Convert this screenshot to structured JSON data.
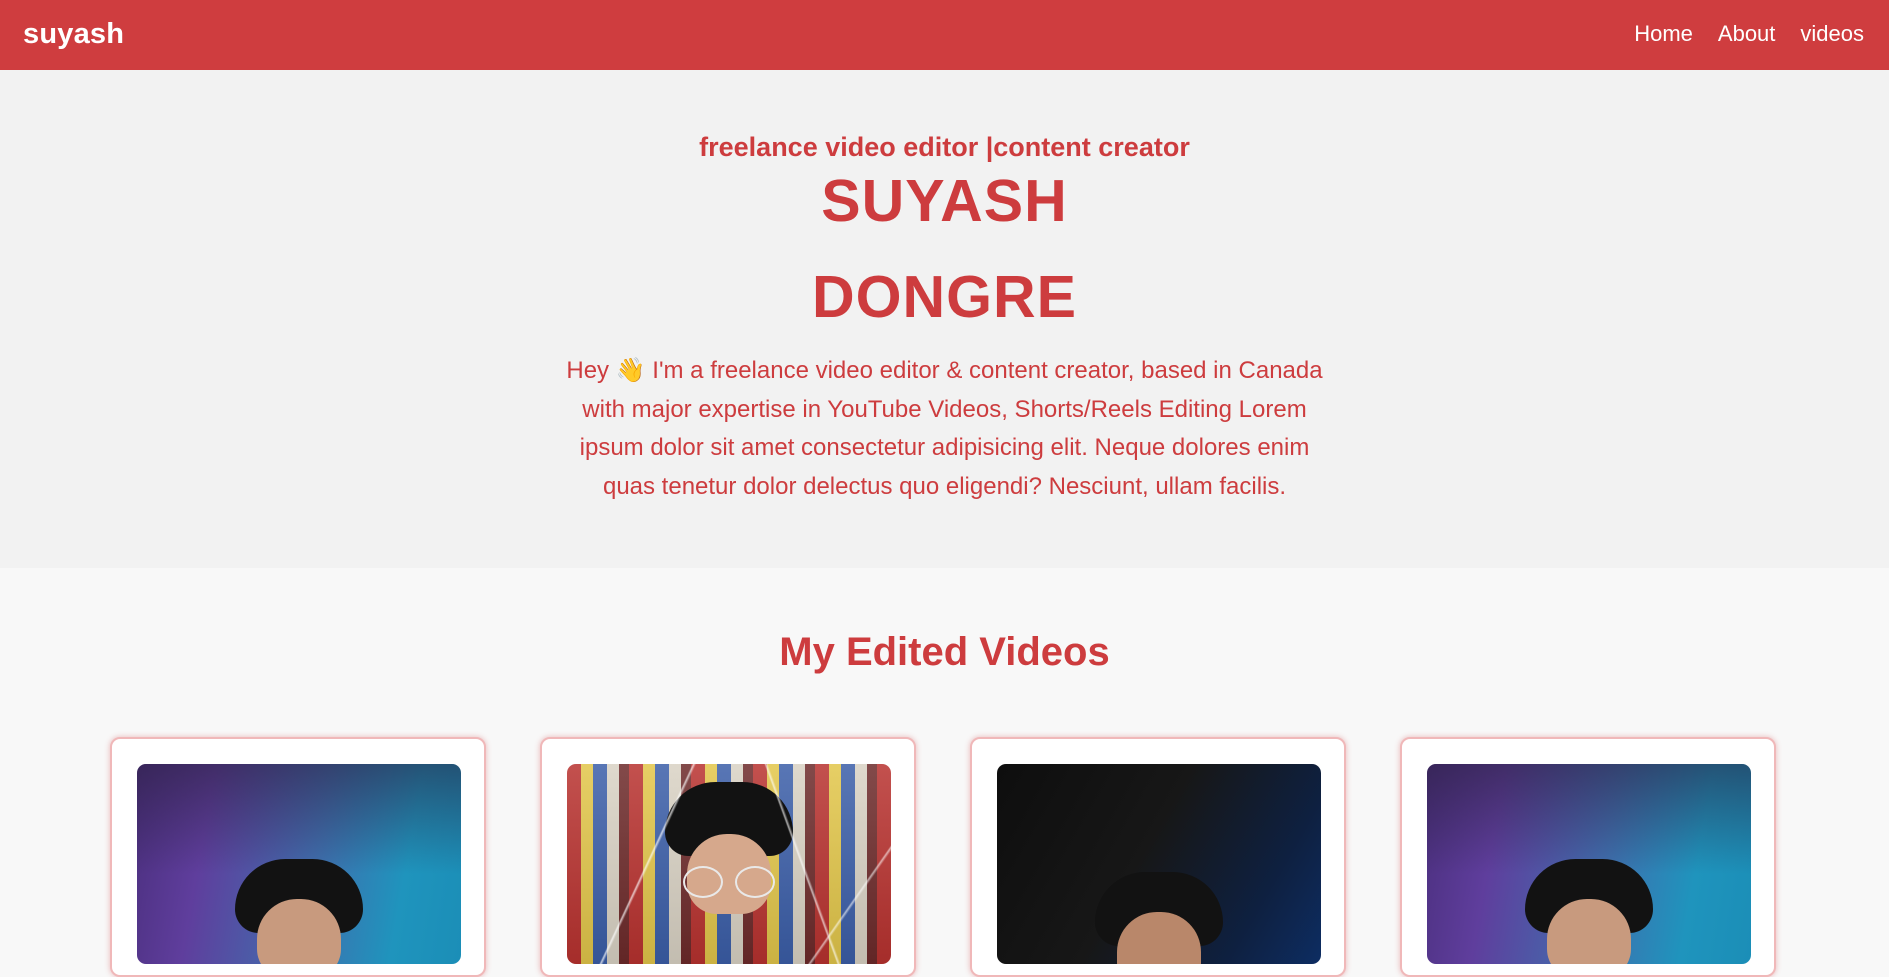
{
  "nav": {
    "brand": "suyash",
    "links": [
      {
        "label": "Home"
      },
      {
        "label": "About"
      },
      {
        "label": "videos"
      }
    ]
  },
  "hero": {
    "tagline": "freelance video editor |content creator",
    "first_name": "SUYASH",
    "last_name": "DONGRE",
    "bio": "Hey 👋 I'm a freelance video editor & content creator, based in Canada with major expertise in YouTube Videos, Shorts/Reels Editing Lorem ipsum dolor sit amet consectetur adipisicing elit. Neque dolores enim quas tenetur dolor delectus quo eligendi? Nesciunt, ullam facilis."
  },
  "videos": {
    "title": "My Edited Videos",
    "cards": [
      {
        "thumbnail": "portrait on purple-teal gradient background"
      },
      {
        "thumbnail": "man with round glasses in store aisle with light streaks"
      },
      {
        "thumbnail": "portrait on dark blue background"
      },
      {
        "thumbnail": "portrait on purple-teal gradient background"
      }
    ]
  },
  "colors": {
    "accent": "#cf3d3f",
    "text_accent": "#cd3c3e",
    "hero_bg": "#f2f2f2",
    "section_bg": "#f8f8f8",
    "card_bg": "#ffffff"
  }
}
